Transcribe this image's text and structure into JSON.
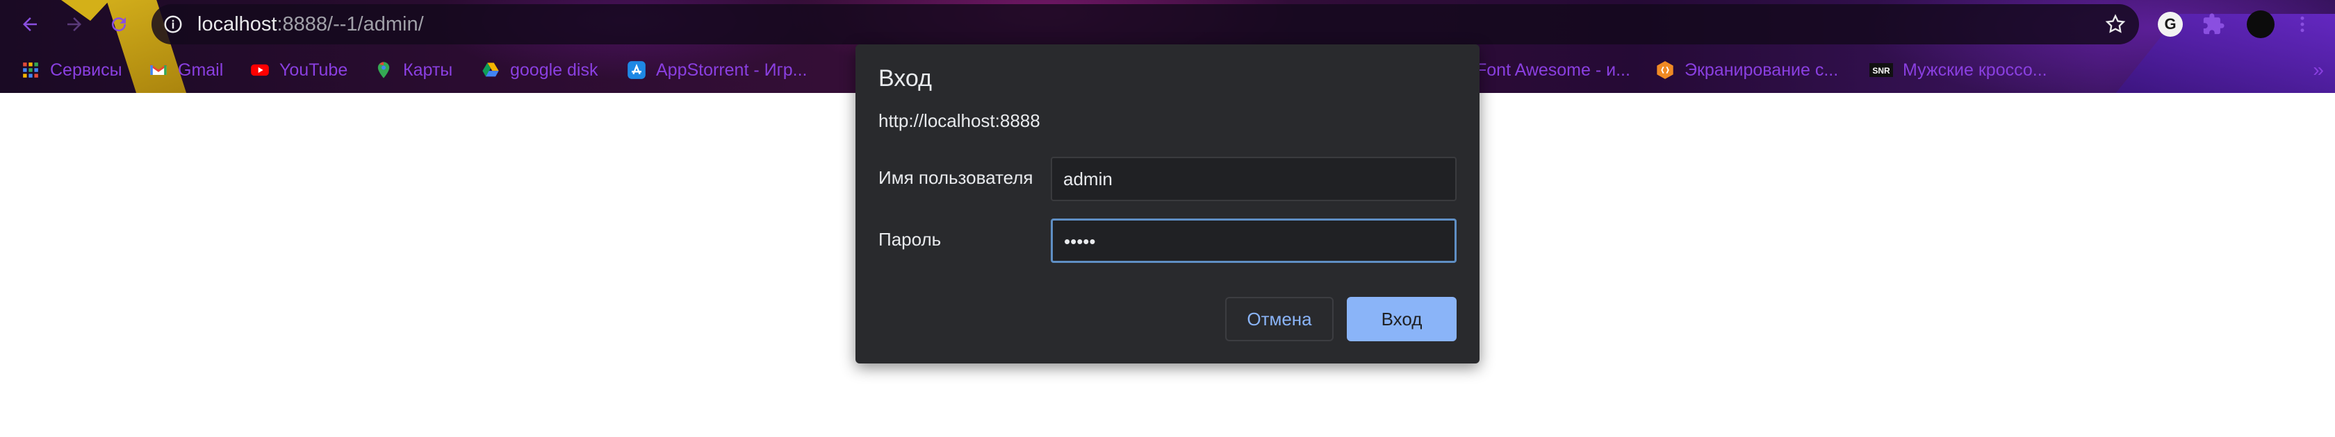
{
  "browser": {
    "url_host": "localhost",
    "url_rest": ":8888/--1/admin/"
  },
  "bookmarks": [
    {
      "label": "Сервисы",
      "icon": "apps-grid-icon"
    },
    {
      "label": "Gmail",
      "icon": "gmail-icon"
    },
    {
      "label": "YouTube",
      "icon": "youtube-icon"
    },
    {
      "label": "Карты",
      "icon": "maps-pin-icon"
    },
    {
      "label": "google disk",
      "icon": "google-drive-icon"
    },
    {
      "label": "AppStorrent - Игр...",
      "icon": "appstore-icon"
    },
    {
      "label": "Font Awesome - и...",
      "icon": "font-awesome-icon"
    },
    {
      "label": "Экранирование с...",
      "icon": "hexagon-icon"
    },
    {
      "label": "Мужские кроссо...",
      "icon": "snr-icon"
    }
  ],
  "bookmarks_more": "»",
  "dialog": {
    "title": "Вход",
    "origin": "http://localhost:8888",
    "username_label": "Имя пользователя",
    "username_value": "admin",
    "password_label": "Пароль",
    "password_value": "•••••",
    "cancel_label": "Отмена",
    "ok_label": "Вход"
  },
  "colors": {
    "dialog_bg": "#292a2d",
    "accent": "#8ab4f8",
    "bookmark_text": "#8a3fe0"
  }
}
